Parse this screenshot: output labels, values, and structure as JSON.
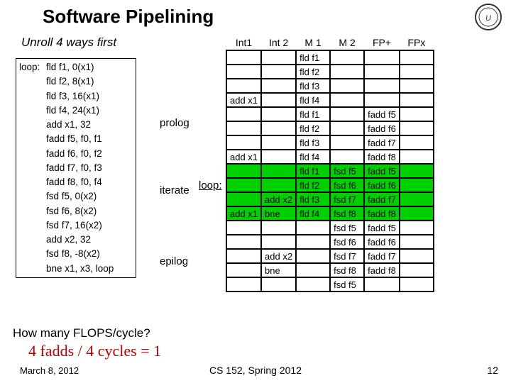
{
  "title": "Software Pipelining",
  "subtitle": "Unroll 4 ways first",
  "code": {
    "label": "loop:",
    "instrs": [
      "fld f1, 0(x1)",
      "fld f2, 8(x1)",
      "fld f3, 16(x1)",
      "fld f4, 24(x1)",
      "add x1, 32",
      "fadd f5, f0, f1",
      "fadd f6, f0, f2",
      "fadd f7, f0, f3",
      "fadd f8, f0, f4",
      "fsd f5, 0(x2)",
      "fsd f6, 8(x2)",
      "fsd f7, 16(x2)",
      "add x2, 32",
      "fsd f8, -8(x2)",
      "bne x1, x3, loop"
    ]
  },
  "stages": {
    "prolog": "prolog",
    "iterate": "iterate",
    "epilog": "epilog"
  },
  "loop_annot": "loop:",
  "sched": {
    "headers": [
      "Int1",
      "Int 2",
      "M 1",
      "M 2",
      "FP+",
      "FPx"
    ],
    "rows": [
      {
        "cells": [
          "",
          "",
          "fld f1",
          "",
          "",
          ""
        ],
        "g": []
      },
      {
        "cells": [
          "",
          "",
          "fld f2",
          "",
          "",
          ""
        ],
        "g": []
      },
      {
        "cells": [
          "",
          "",
          "fld f3",
          "",
          "",
          ""
        ],
        "g": []
      },
      {
        "cells": [
          "add x1",
          "",
          "fld f4",
          "",
          "",
          ""
        ],
        "g": []
      },
      {
        "cells": [
          "",
          "",
          "fld f1",
          "",
          "fadd f5",
          ""
        ],
        "g": []
      },
      {
        "cells": [
          "",
          "",
          "fld f2",
          "",
          "fadd f6",
          ""
        ],
        "g": []
      },
      {
        "cells": [
          "",
          "",
          "fld f3",
          "",
          "fadd f7",
          ""
        ],
        "g": []
      },
      {
        "cells": [
          "add x1",
          "",
          "fld f4",
          "",
          "fadd f8",
          ""
        ],
        "g": []
      },
      {
        "cells": [
          "",
          "",
          "fld f1",
          "fsd f5",
          "fadd f5",
          ""
        ],
        "g": [
          0,
          1,
          2,
          3,
          4,
          5
        ]
      },
      {
        "cells": [
          "",
          "",
          "fld f2",
          "fsd f6",
          "fadd f6",
          ""
        ],
        "g": [
          0,
          1,
          2,
          3,
          4,
          5
        ]
      },
      {
        "cells": [
          "",
          "add x2",
          "fld f3",
          "fsd f7",
          "fadd f7",
          ""
        ],
        "g": [
          0,
          1,
          2,
          3,
          4,
          5
        ]
      },
      {
        "cells": [
          "add x1",
          "bne",
          "fld f4",
          "fsd f8",
          "fadd f8",
          ""
        ],
        "g": [
          0,
          1,
          2,
          3,
          4,
          5
        ]
      },
      {
        "cells": [
          "",
          "",
          "",
          "fsd f5",
          "fadd f5",
          ""
        ],
        "g": []
      },
      {
        "cells": [
          "",
          "",
          "",
          "fsd f6",
          "fadd f6",
          ""
        ],
        "g": []
      },
      {
        "cells": [
          "",
          "add x2",
          "",
          "fsd f7",
          "fadd f7",
          ""
        ],
        "g": []
      },
      {
        "cells": [
          "",
          "bne",
          "",
          "fsd f8",
          "fadd f8",
          ""
        ],
        "g": []
      },
      {
        "cells": [
          "",
          "",
          "",
          "fsd f5",
          "",
          ""
        ],
        "g": []
      }
    ]
  },
  "question": "How many FLOPS/cycle?",
  "answer": "4 fadds / 4 cycles = 1",
  "footer": {
    "date": "March 8, 2012",
    "course": "CS 152, Spring 2012",
    "slide": "12"
  }
}
